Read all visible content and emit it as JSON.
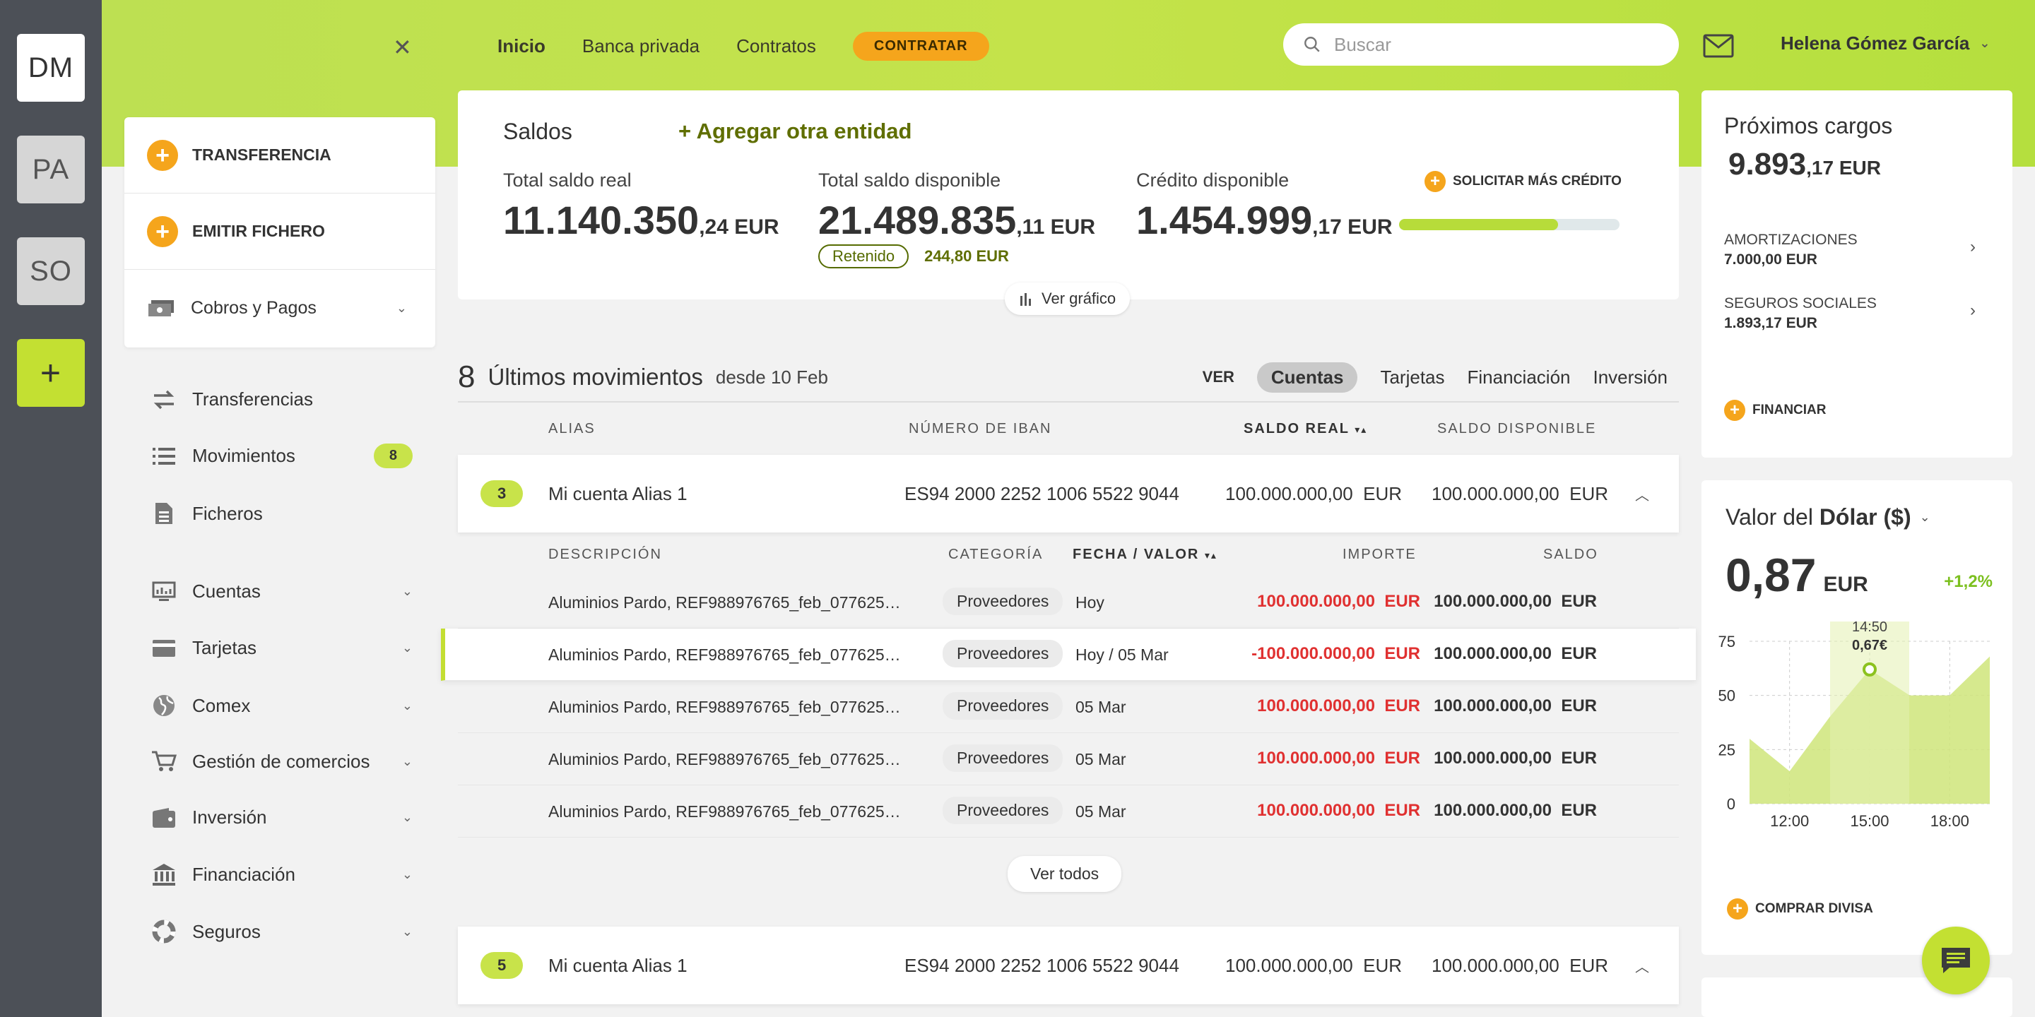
{
  "rail": {
    "tiles": [
      "DM",
      "PA",
      "SO",
      "+"
    ]
  },
  "topnav": {
    "inicio": "Inicio",
    "banca": "Banca privada",
    "contratos": "Contratos",
    "contratar": "CONTRATAR"
  },
  "search": {
    "placeholder": "Buscar"
  },
  "user": {
    "name": "Helena Gómez García"
  },
  "actions": {
    "transferencia": "TRANSFERENCIA",
    "emitir": "EMITIR FICHERO",
    "cobros": "Cobros y Pagos"
  },
  "sidebar": {
    "transferencias": "Transferencias",
    "movimientos": "Movimientos",
    "movimientos_badge": "8",
    "ficheros": "Ficheros",
    "cuentas": "Cuentas",
    "tarjetas": "Tarjetas",
    "comex": "Comex",
    "gestion": "Gestión de comercios",
    "inversion": "Inversión",
    "financiacion": "Financiación",
    "seguros": "Seguros"
  },
  "saldos": {
    "title": "Saldos",
    "add": "+ Agregar otra entidad",
    "real_label": "Total saldo real",
    "real_int": "11.140.350",
    "real_dec": ",24 EUR",
    "disp_label": "Total saldo disponible",
    "disp_int": "21.489.835",
    "disp_dec": ",11 EUR",
    "retenido": "Retenido",
    "retenido_amt": "244,80 EUR",
    "cred_label": "Crédito disponible",
    "cred_int": "1.454.999",
    "cred_dec": ",17 EUR",
    "solicitar": "SOLICITAR MÁS CRÉDITO",
    "credit_fill_pct": 72,
    "ver_grafico": "Ver gráfico"
  },
  "movimientos": {
    "count": "8",
    "title": "Últimos movimientos",
    "since": "desde 10 Feb",
    "ver": "VER",
    "filters": [
      "Cuentas",
      "Tarjetas",
      "Financiación",
      "Inversión"
    ],
    "cols": {
      "alias": "ALIAS",
      "iban": "NÚMERO DE IBAN",
      "real": "SALDO REAL",
      "disp": "SALDO DISPONIBLE"
    },
    "txcols": {
      "desc": "DESCRIPCIÓN",
      "cat": "CATEGORÍA",
      "fecha": "FECHA / VALOR",
      "importe": "IMPORTE",
      "saldo": "SALDO"
    },
    "accounts": [
      {
        "count": "3",
        "alias": "Mi cuenta Alias 1",
        "iban": "ES94 2000 2252 1006 5522 9044",
        "real": "100.000.000,00  EUR",
        "disp": "100.000.000,00  EUR"
      },
      {
        "count": "5",
        "alias": "Mi cuenta Alias 1",
        "iban": "ES94 2000 2252 1006 5522 9044",
        "real": "100.000.000,00  EUR",
        "disp": "100.000.000,00  EUR"
      }
    ],
    "rows": [
      {
        "desc": "Aluminios Pardo, REF988976765_feb_077625…",
        "cat": "Proveedores",
        "fecha": "Hoy",
        "importe": "100.000.000,00  EUR",
        "saldo": "100.000.000,00  EUR"
      },
      {
        "desc": "Aluminios Pardo, REF988976765_feb_077625…",
        "cat": "Proveedores",
        "fecha": "Hoy / 05 Mar",
        "importe": "-100.000.000,00  EUR",
        "saldo": "100.000.000,00  EUR"
      },
      {
        "desc": "Aluminios Pardo, REF988976765_feb_077625…",
        "cat": "Proveedores",
        "fecha": "05 Mar",
        "importe": "100.000.000,00  EUR",
        "saldo": "100.000.000,00  EUR"
      },
      {
        "desc": "Aluminios Pardo, REF988976765_feb_077625…",
        "cat": "Proveedores",
        "fecha": "05 Mar",
        "importe": "100.000.000,00  EUR",
        "saldo": "100.000.000,00  EUR"
      },
      {
        "desc": "Aluminios Pardo, REF988976765_feb_077625…",
        "cat": "Proveedores",
        "fecha": "05 Mar",
        "importe": "100.000.000,00  EUR",
        "saldo": "100.000.000,00  EUR"
      }
    ],
    "ver_todos": "Ver todos"
  },
  "proximos": {
    "title": "Próximos cargos",
    "int": "9.893",
    "dec": ",17 EUR",
    "items": [
      {
        "label": "AMORTIZACIONES",
        "amount": "7.000,00 EUR"
      },
      {
        "label": "SEGUROS SOCIALES",
        "amount": "1.893,17 EUR"
      }
    ],
    "financiar": "FINANCIAR"
  },
  "divisa": {
    "title_pre": "Valor del",
    "title_cur": "Dólar ($)",
    "value": "0,87",
    "unit": "EUR",
    "change": "+1,2%",
    "tip_time": "14:50",
    "tip_val": "0,67€",
    "comprar": "COMPRAR DIVISA"
  },
  "chart_data": {
    "type": "area",
    "x": [
      "11:00",
      "12:00",
      "13:00",
      "14:50",
      "16:00",
      "17:00",
      "19:00"
    ],
    "values": [
      30,
      15,
      40,
      62,
      50,
      50,
      68
    ],
    "xticks": [
      "12:00",
      "15:00",
      "18:00"
    ],
    "yticks": [
      "75",
      "50",
      "25",
      "0"
    ],
    "ylim": [
      0,
      75
    ]
  },
  "colors": {
    "accent": "#c3e032",
    "orange": "#f5a51c",
    "negative": "#e03131"
  }
}
